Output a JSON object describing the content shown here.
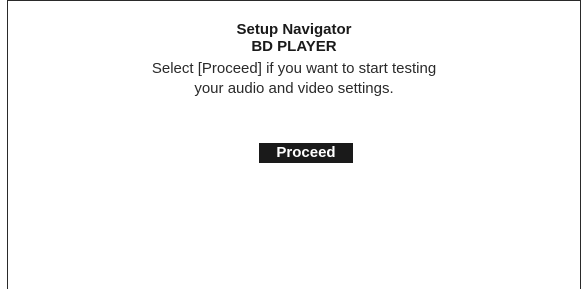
{
  "navigator": {
    "title": "Setup Navigator",
    "subtitle": "BD PLAYER",
    "message_lines": [
      "Select [Proceed] if you want to start testing",
      "your audio and video settings."
    ],
    "proceed_label": "Proceed"
  },
  "colors": {
    "background": "#ffffff",
    "text": "#1a1a1a",
    "button_background": "#1a1a1a",
    "button_text": "#ffffff"
  }
}
